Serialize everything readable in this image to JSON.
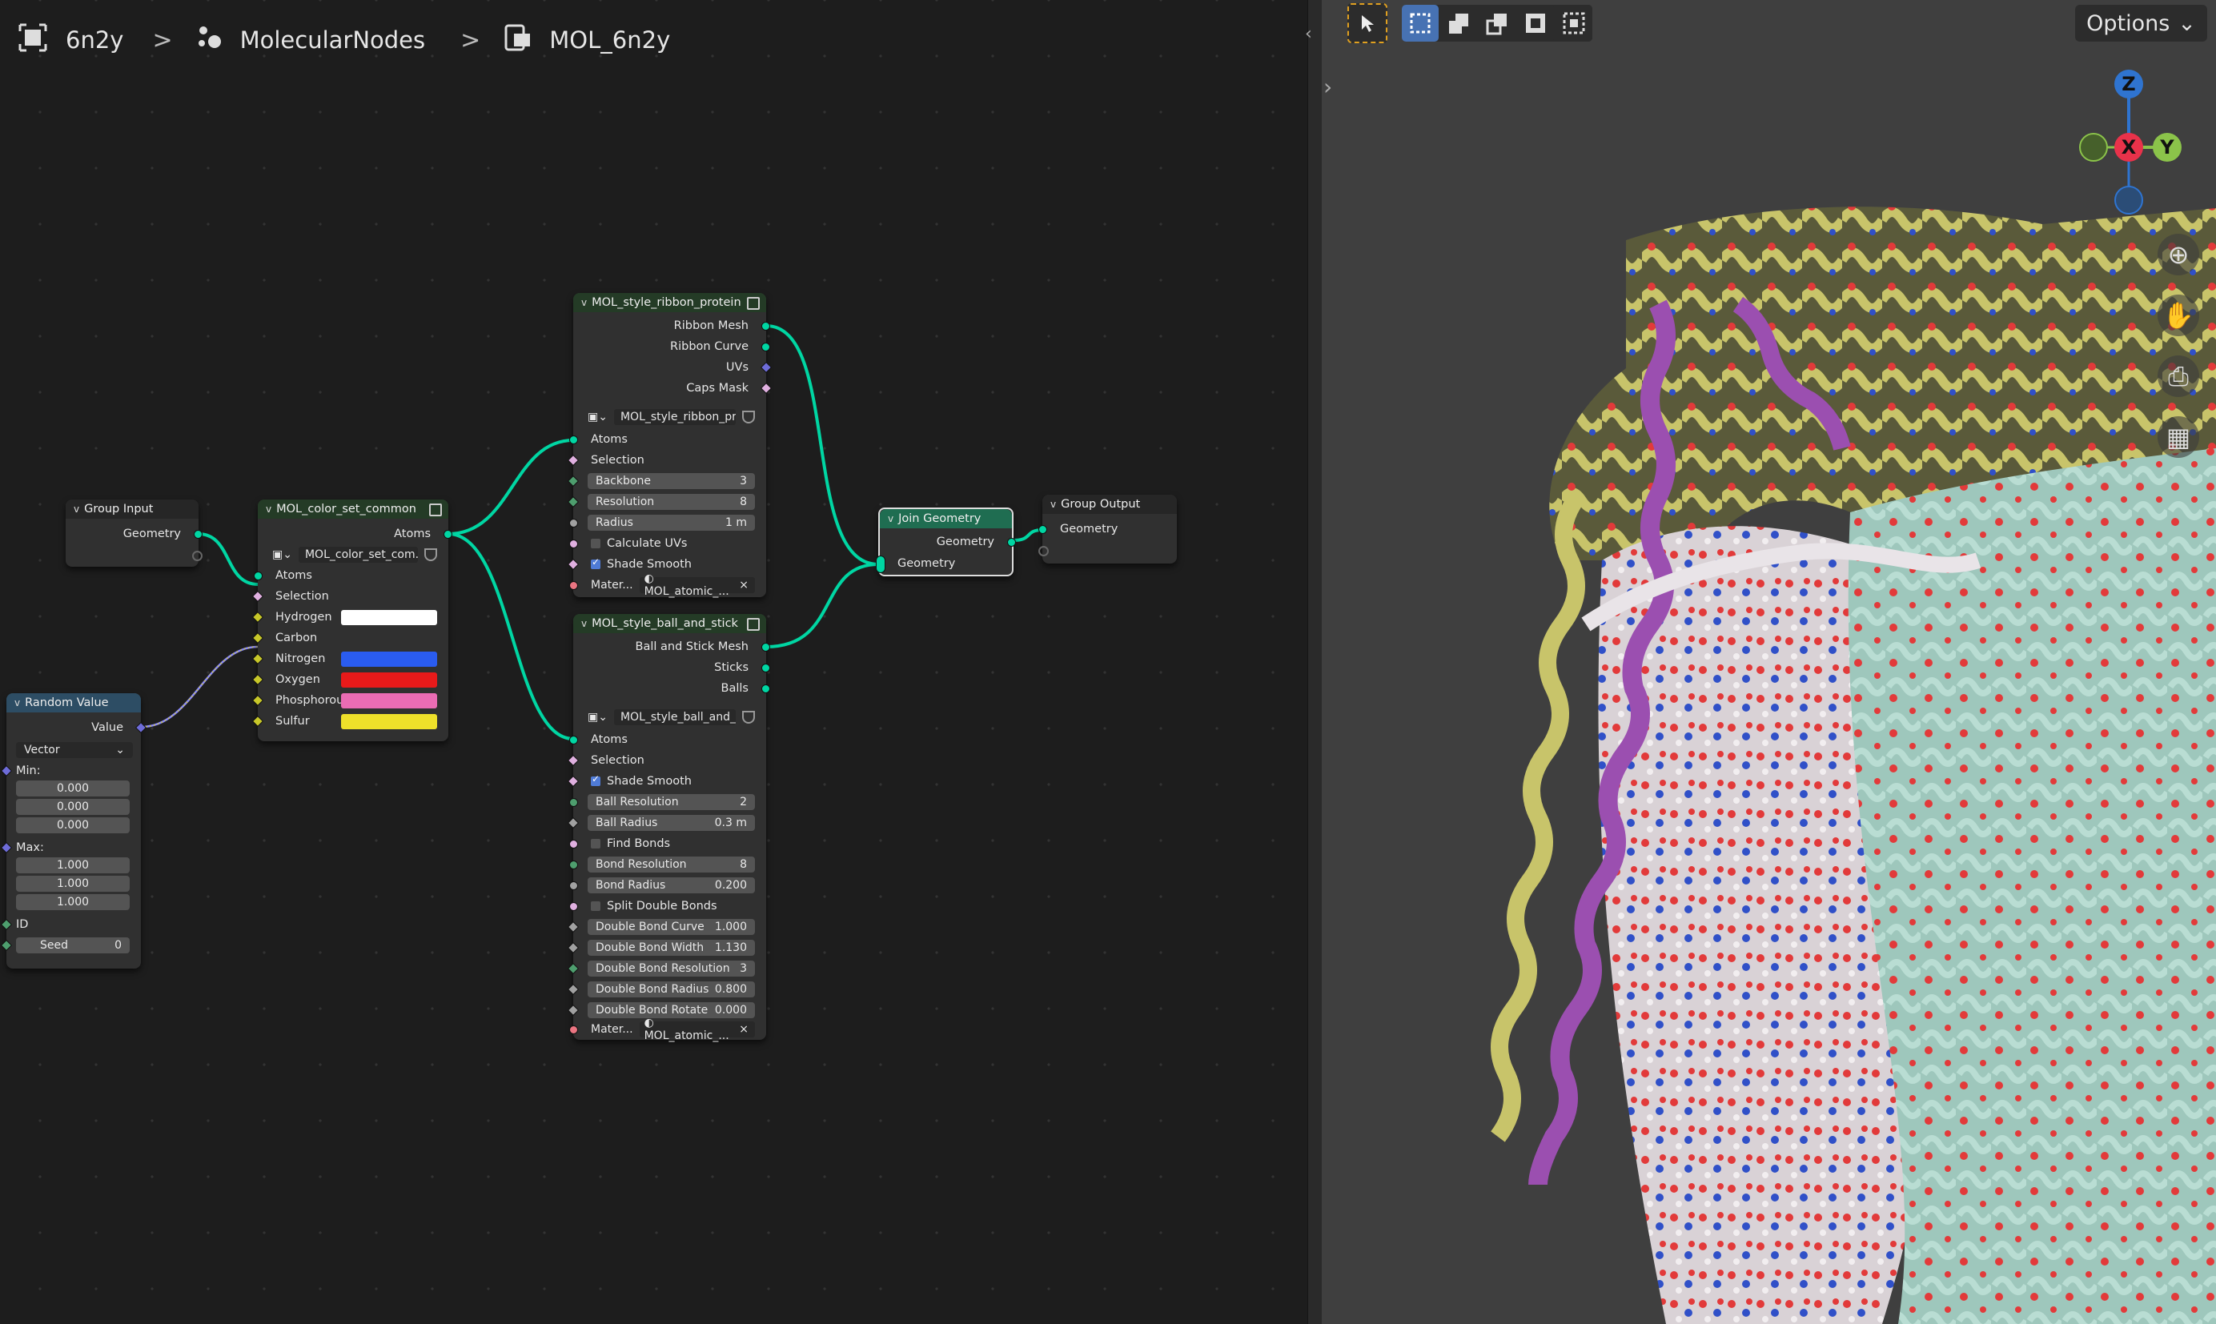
{
  "breadcrumb": {
    "object": "6n2y",
    "modifier": "MolecularNodes",
    "node_group": "MOL_6n2y"
  },
  "nodes": {
    "group_input": {
      "title": "Group Input",
      "geometry": "Geometry"
    },
    "color_set": {
      "title": "MOL_color_set_common",
      "atoms_out": "Atoms",
      "group_name": "MOL_color_set_com...",
      "inputs": [
        "Atoms",
        "Selection",
        "Hydrogen",
        "Carbon",
        "Nitrogen",
        "Oxygen",
        "Phosphorous",
        "Sulfur"
      ],
      "colors": {
        "hydrogen": "#ffffff",
        "nitrogen": "#2a5cf0",
        "oxygen": "#e81a1a",
        "phosphorous": "#ea6cb4",
        "sulfur": "#eee02a"
      }
    },
    "random_value": {
      "title": "Random Value",
      "value": "Value",
      "type": "Vector",
      "min_label": "Min:",
      "min": [
        "0.000",
        "0.000",
        "0.000"
      ],
      "max_label": "Max:",
      "max": [
        "1.000",
        "1.000",
        "1.000"
      ],
      "id": "ID",
      "seed_label": "Seed",
      "seed": "0"
    },
    "ribbon": {
      "title": "MOL_style_ribbon_protein",
      "outputs": [
        "Ribbon Mesh",
        "Ribbon Curve",
        "UVs",
        "Caps Mask"
      ],
      "group_name": "MOL_style_ribbon_pr...",
      "atoms": "Atoms",
      "selection": "Selection",
      "backbone_label": "Backbone",
      "backbone": "3",
      "resolution_label": "Resolution",
      "resolution": "8",
      "radius_label": "Radius",
      "radius": "1 m",
      "calc_uvs": "Calculate UVs",
      "shade_smooth": "Shade Smooth",
      "mat_label": "Mater...",
      "material": "MOL_atomic_..."
    },
    "ballstick": {
      "title": "MOL_style_ball_and_stick",
      "outputs": [
        "Ball and Stick Mesh",
        "Sticks",
        "Balls"
      ],
      "group_name": "MOL_style_ball_and_...",
      "atoms": "Atoms",
      "selection": "Selection",
      "shade_smooth": "Shade Smooth",
      "fields": [
        {
          "label": "Ball Resolution",
          "value": "2"
        },
        {
          "label": "Ball Radius",
          "value": "0.3 m"
        }
      ],
      "find_bonds": "Find Bonds",
      "fields2": [
        {
          "label": "Bond Resolution",
          "value": "8"
        },
        {
          "label": "Bond Radius",
          "value": "0.200"
        }
      ],
      "split_double": "Split Double Bonds",
      "fields3": [
        {
          "label": "Double Bond Curve",
          "value": "1.000"
        },
        {
          "label": "Double Bond Width",
          "value": "1.130"
        },
        {
          "label": "Double Bond Resolution",
          "value": "3"
        },
        {
          "label": "Double Bond Radius",
          "value": "0.800"
        },
        {
          "label": "Double Bond Rotate",
          "value": "0.000"
        }
      ],
      "mat_label": "Mater...",
      "material": "MOL_atomic_..."
    },
    "join": {
      "title": "Join Geometry",
      "out": "Geometry",
      "in": "Geometry"
    },
    "group_output": {
      "title": "Group Output",
      "in": "Geometry"
    }
  },
  "viewport": {
    "options": "Options",
    "gizmo": {
      "z": "Z",
      "x": "X",
      "y": "Y"
    },
    "colors": {
      "x": "#e8324a",
      "y": "#8bc34a",
      "z": "#2f74d0"
    }
  }
}
